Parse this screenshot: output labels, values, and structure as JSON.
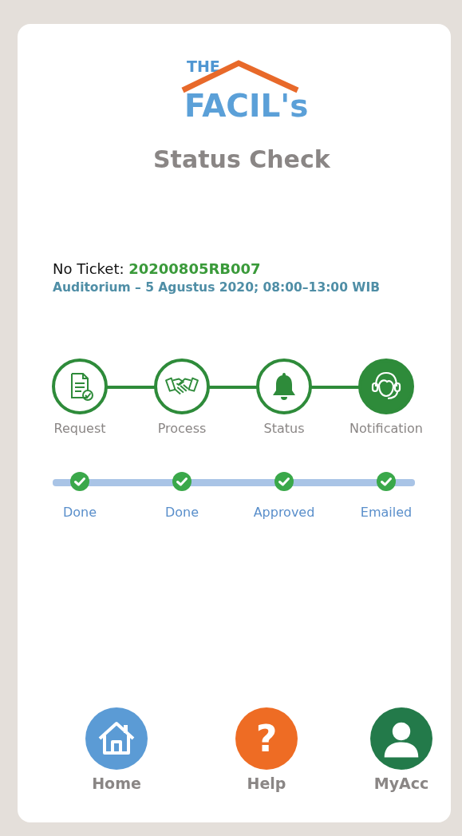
{
  "logo": {
    "top": "THE",
    "name": "FACIL's"
  },
  "title": "Status Check",
  "ticket": {
    "label": "No Ticket:",
    "number": "20200805RB007",
    "details": "Auditorium  –  5 Agustus 2020; 08:00–13:00 WIB"
  },
  "steps": [
    {
      "kind": "request",
      "label": "Request",
      "selected": false
    },
    {
      "kind": "process",
      "label": "Process",
      "selected": false
    },
    {
      "kind": "status",
      "label": "Status",
      "selected": false
    },
    {
      "kind": "notification",
      "label": "Notification",
      "selected": true
    }
  ],
  "progress": [
    {
      "label": "Done",
      "checked": true
    },
    {
      "label": "Done",
      "checked": true
    },
    {
      "label": "Approved",
      "checked": true
    },
    {
      "label": "Emailed",
      "checked": true
    }
  ],
  "nav": [
    {
      "kind": "home",
      "label": "Home"
    },
    {
      "kind": "help",
      "label": "Help",
      "glyph": "?"
    },
    {
      "kind": "account",
      "label": "MyAcc"
    }
  ]
}
